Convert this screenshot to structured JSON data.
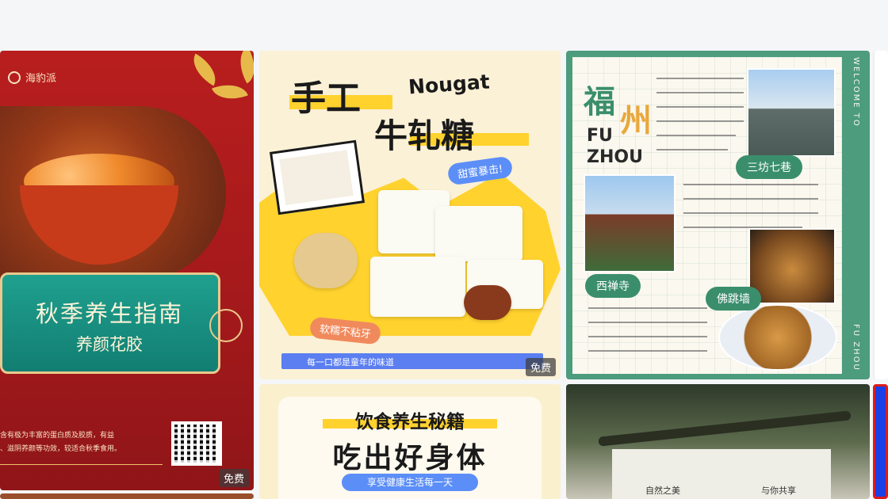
{
  "page": {
    "background": "#f5f6f8"
  },
  "cards": [
    {
      "id": "autumn-guide",
      "brand": "海豹派",
      "title": "秋季养生指南",
      "subtitle": "养颜花胶",
      "description_line1": "含有极为丰富的蛋白质及胶质，有益",
      "description_line2": "、滋阴养颜等功效，较适合秋季食用。",
      "badge": "免费",
      "accent_color": "#b81e1e"
    },
    {
      "id": "nougat",
      "title_cn_1": "手工",
      "title_en": "Nougat",
      "title_cn_2": "牛轧糖",
      "tag_1": "甜蜜暴击!",
      "tag_2": "软糯不粘牙",
      "footer_text": "每一口都是童年的味道",
      "badge": "免费",
      "accent_color": "#ffd22e"
    },
    {
      "id": "fuzhou",
      "title_cn_1": "福",
      "title_cn_2": "州",
      "title_en_1": "FU",
      "title_en_2": "ZHOU",
      "tag_1": "三坊七巷",
      "tag_2": "西禅寺",
      "tag_3": "佛跳墙",
      "side_text_top": "WELCOME TO",
      "side_text_bottom": "FU ZHOU",
      "accent_color": "#4c9c7d"
    },
    {
      "id": "diet-secrets",
      "title_1": "饮食养生秘籍",
      "title_2": "吃出好身体",
      "pill": "享受健康生活每一天"
    },
    {
      "id": "nature-cloth",
      "text_left": "自然之美",
      "text_right": "与你共享"
    }
  ]
}
